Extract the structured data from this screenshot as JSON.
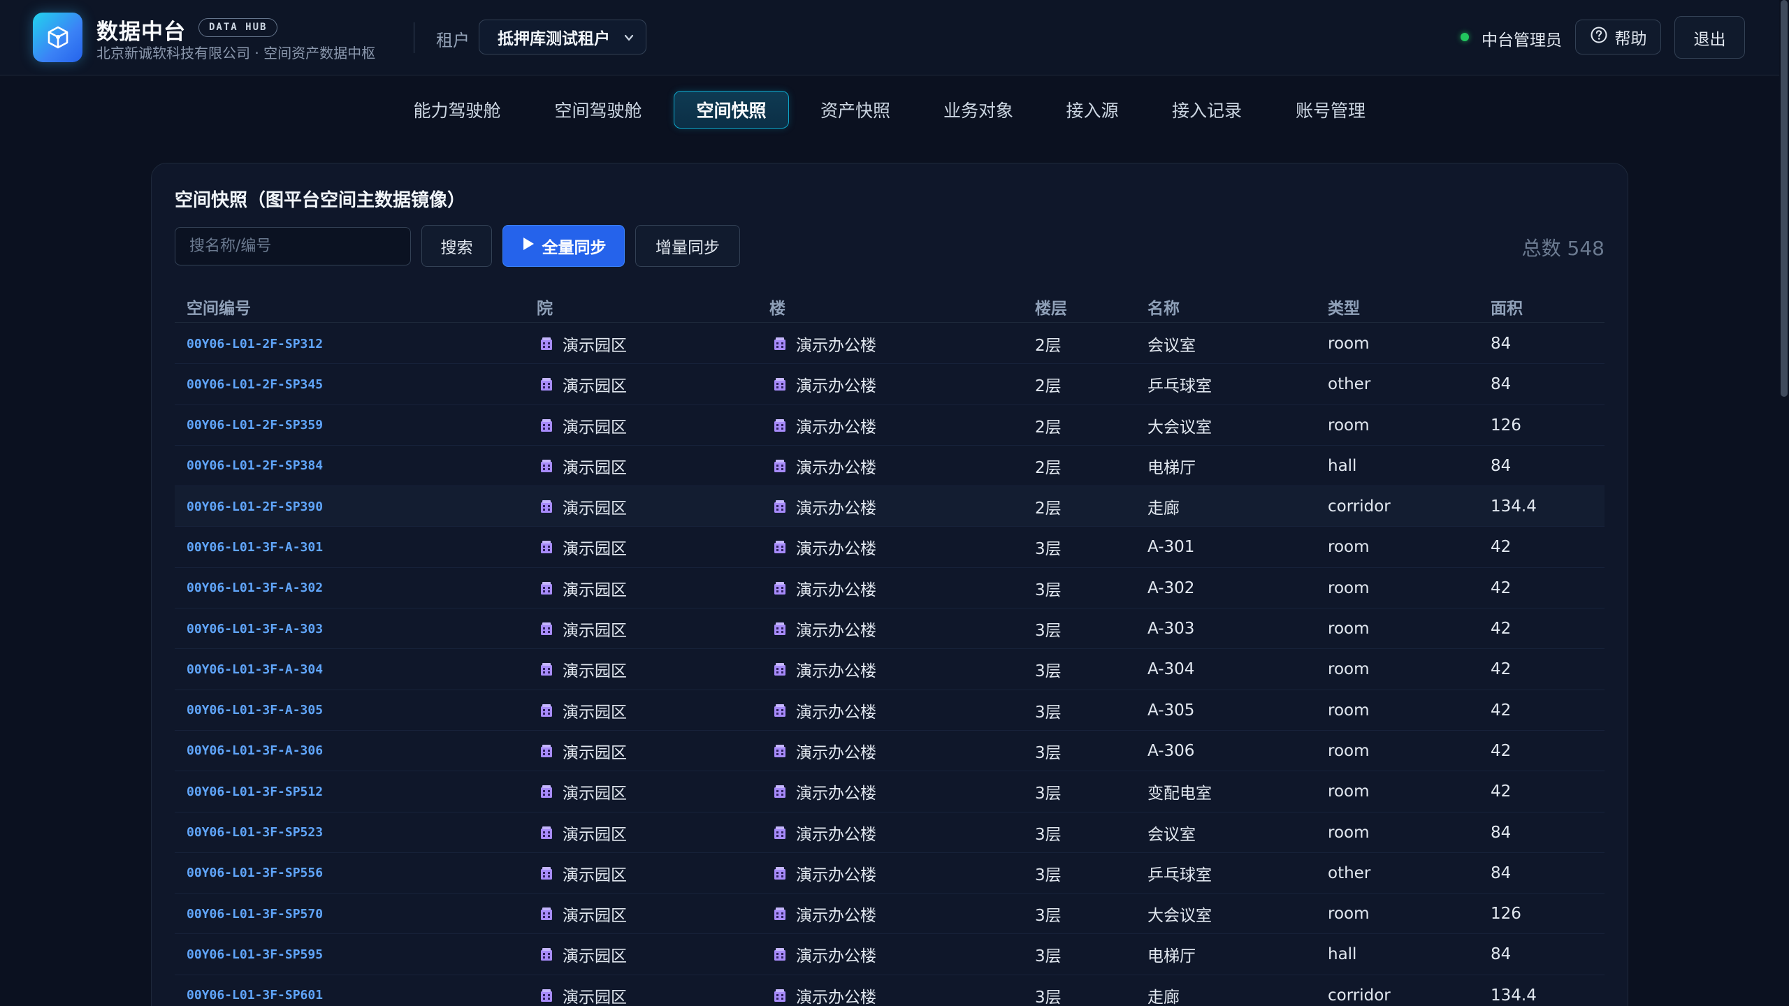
{
  "brand": {
    "title": "数据中台",
    "badge": "DATA HUB",
    "subtitle": "北京新诚软科技有限公司 · 空间资产数据中枢",
    "logo_icon": "cube-icon"
  },
  "tenant": {
    "label": "租户",
    "selected": "抵押库测试租户"
  },
  "user": {
    "role": "中台管理员",
    "status_color": "#22c55e"
  },
  "actions": {
    "help": "帮助",
    "logout": "退出"
  },
  "nav": {
    "tabs": [
      {
        "label": "能力驾驶舱",
        "active": false
      },
      {
        "label": "空间驾驶舱",
        "active": false
      },
      {
        "label": "空间快照",
        "active": true
      },
      {
        "label": "资产快照",
        "active": false
      },
      {
        "label": "业务对象",
        "active": false
      },
      {
        "label": "接入源",
        "active": false
      },
      {
        "label": "接入记录",
        "active": false
      },
      {
        "label": "账号管理",
        "active": false
      }
    ]
  },
  "panel": {
    "title": "空间快照（图平台空间主数据镜像）",
    "search_placeholder": "搜名称/编号",
    "search_button": "搜索",
    "full_sync_button": "全量同步",
    "incremental_sync_button": "增量同步",
    "total": "总数 548"
  },
  "table": {
    "columns": [
      "空间编号",
      "院",
      "楼",
      "楼层",
      "名称",
      "类型",
      "面积"
    ],
    "rows": [
      [
        "00Y06-L01-2F-SP312",
        "演示园区",
        "演示办公楼",
        "2层",
        "会议室",
        "room",
        "84"
      ],
      [
        "00Y06-L01-2F-SP345",
        "演示园区",
        "演示办公楼",
        "2层",
        "乒乓球室",
        "other",
        "84"
      ],
      [
        "00Y06-L01-2F-SP359",
        "演示园区",
        "演示办公楼",
        "2层",
        "大会议室",
        "room",
        "126"
      ],
      [
        "00Y06-L01-2F-SP384",
        "演示园区",
        "演示办公楼",
        "2层",
        "电梯厅",
        "hall",
        "84"
      ],
      [
        "00Y06-L01-2F-SP390",
        "演示园区",
        "演示办公楼",
        "2层",
        "走廊",
        "corridor",
        "134.4"
      ],
      [
        "00Y06-L01-3F-A-301",
        "演示园区",
        "演示办公楼",
        "3层",
        "A-301",
        "room",
        "42"
      ],
      [
        "00Y06-L01-3F-A-302",
        "演示园区",
        "演示办公楼",
        "3层",
        "A-302",
        "room",
        "42"
      ],
      [
        "00Y06-L01-3F-A-303",
        "演示园区",
        "演示办公楼",
        "3层",
        "A-303",
        "room",
        "42"
      ],
      [
        "00Y06-L01-3F-A-304",
        "演示园区",
        "演示办公楼",
        "3层",
        "A-304",
        "room",
        "42"
      ],
      [
        "00Y06-L01-3F-A-305",
        "演示园区",
        "演示办公楼",
        "3层",
        "A-305",
        "room",
        "42"
      ],
      [
        "00Y06-L01-3F-A-306",
        "演示园区",
        "演示办公楼",
        "3层",
        "A-306",
        "room",
        "42"
      ],
      [
        "00Y06-L01-3F-SP512",
        "演示园区",
        "演示办公楼",
        "3层",
        "变配电室",
        "room",
        "42"
      ],
      [
        "00Y06-L01-3F-SP523",
        "演示园区",
        "演示办公楼",
        "3层",
        "会议室",
        "room",
        "84"
      ],
      [
        "00Y06-L01-3F-SP556",
        "演示园区",
        "演示办公楼",
        "3层",
        "乒乓球室",
        "other",
        "84"
      ],
      [
        "00Y06-L01-3F-SP570",
        "演示园区",
        "演示办公楼",
        "3层",
        "大会议室",
        "room",
        "126"
      ],
      [
        "00Y06-L01-3F-SP595",
        "演示园区",
        "演示办公楼",
        "3层",
        "电梯厅",
        "hall",
        "84"
      ],
      [
        "00Y06-L01-3F-SP601",
        "演示园区",
        "演示办公楼",
        "3层",
        "走廊",
        "corridor",
        "134.4"
      ]
    ],
    "highlighted_row": 4,
    "campus_icon": "building-icon",
    "building_icon": "building-icon"
  },
  "colors": {
    "accent": "#0ea5c9",
    "primary": "#2563eb",
    "code_text": "#60a5fa",
    "background": "#0b1120"
  }
}
